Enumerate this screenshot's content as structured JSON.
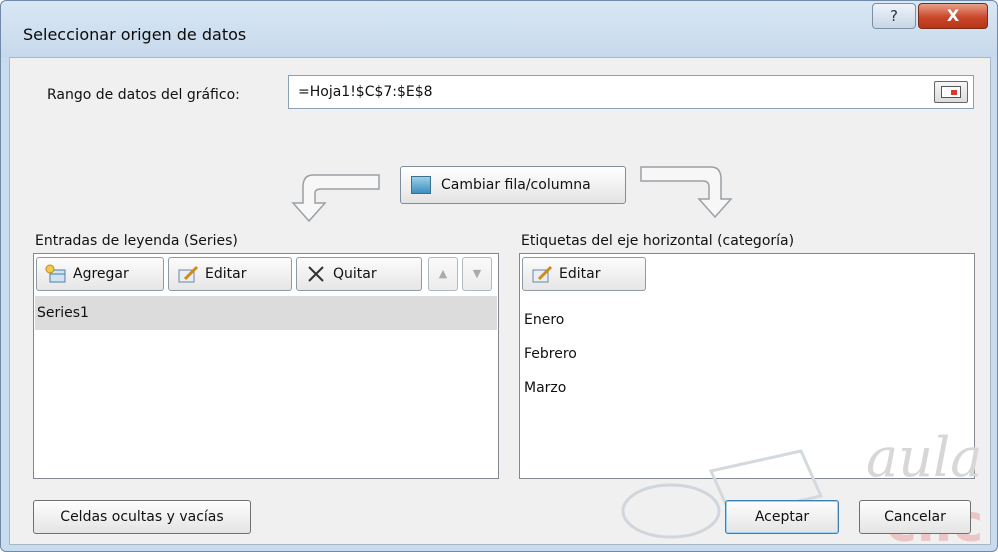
{
  "window": {
    "title": "Seleccionar origen de datos",
    "help_label": "?",
    "close_label": "X"
  },
  "range": {
    "label": "Rango de datos del gráfico:",
    "value": "=Hoja1!$C$7:$E$8"
  },
  "swap_button": {
    "label": "Cambiar fila/columna"
  },
  "legend_panel": {
    "label": "Entradas de leyenda (Series)",
    "add_label": "Agregar",
    "edit_label": "Editar",
    "remove_label": "Quitar",
    "up_label": "▲",
    "down_label": "▼",
    "series": [
      "Series1"
    ]
  },
  "category_panel": {
    "label": "Etiquetas del eje horizontal (categoría)",
    "edit_label": "Editar",
    "items": [
      "Enero",
      "Febrero",
      "Marzo"
    ]
  },
  "footer": {
    "hidden_cells_label": "Celdas ocultas y vacías",
    "ok_label": "Aceptar",
    "cancel_label": "Cancelar"
  },
  "watermark": {
    "text": "aula clic"
  },
  "colors": {
    "titlebar": "#c9dced",
    "close": "#c9472a",
    "selection": "#dcdcdc"
  }
}
